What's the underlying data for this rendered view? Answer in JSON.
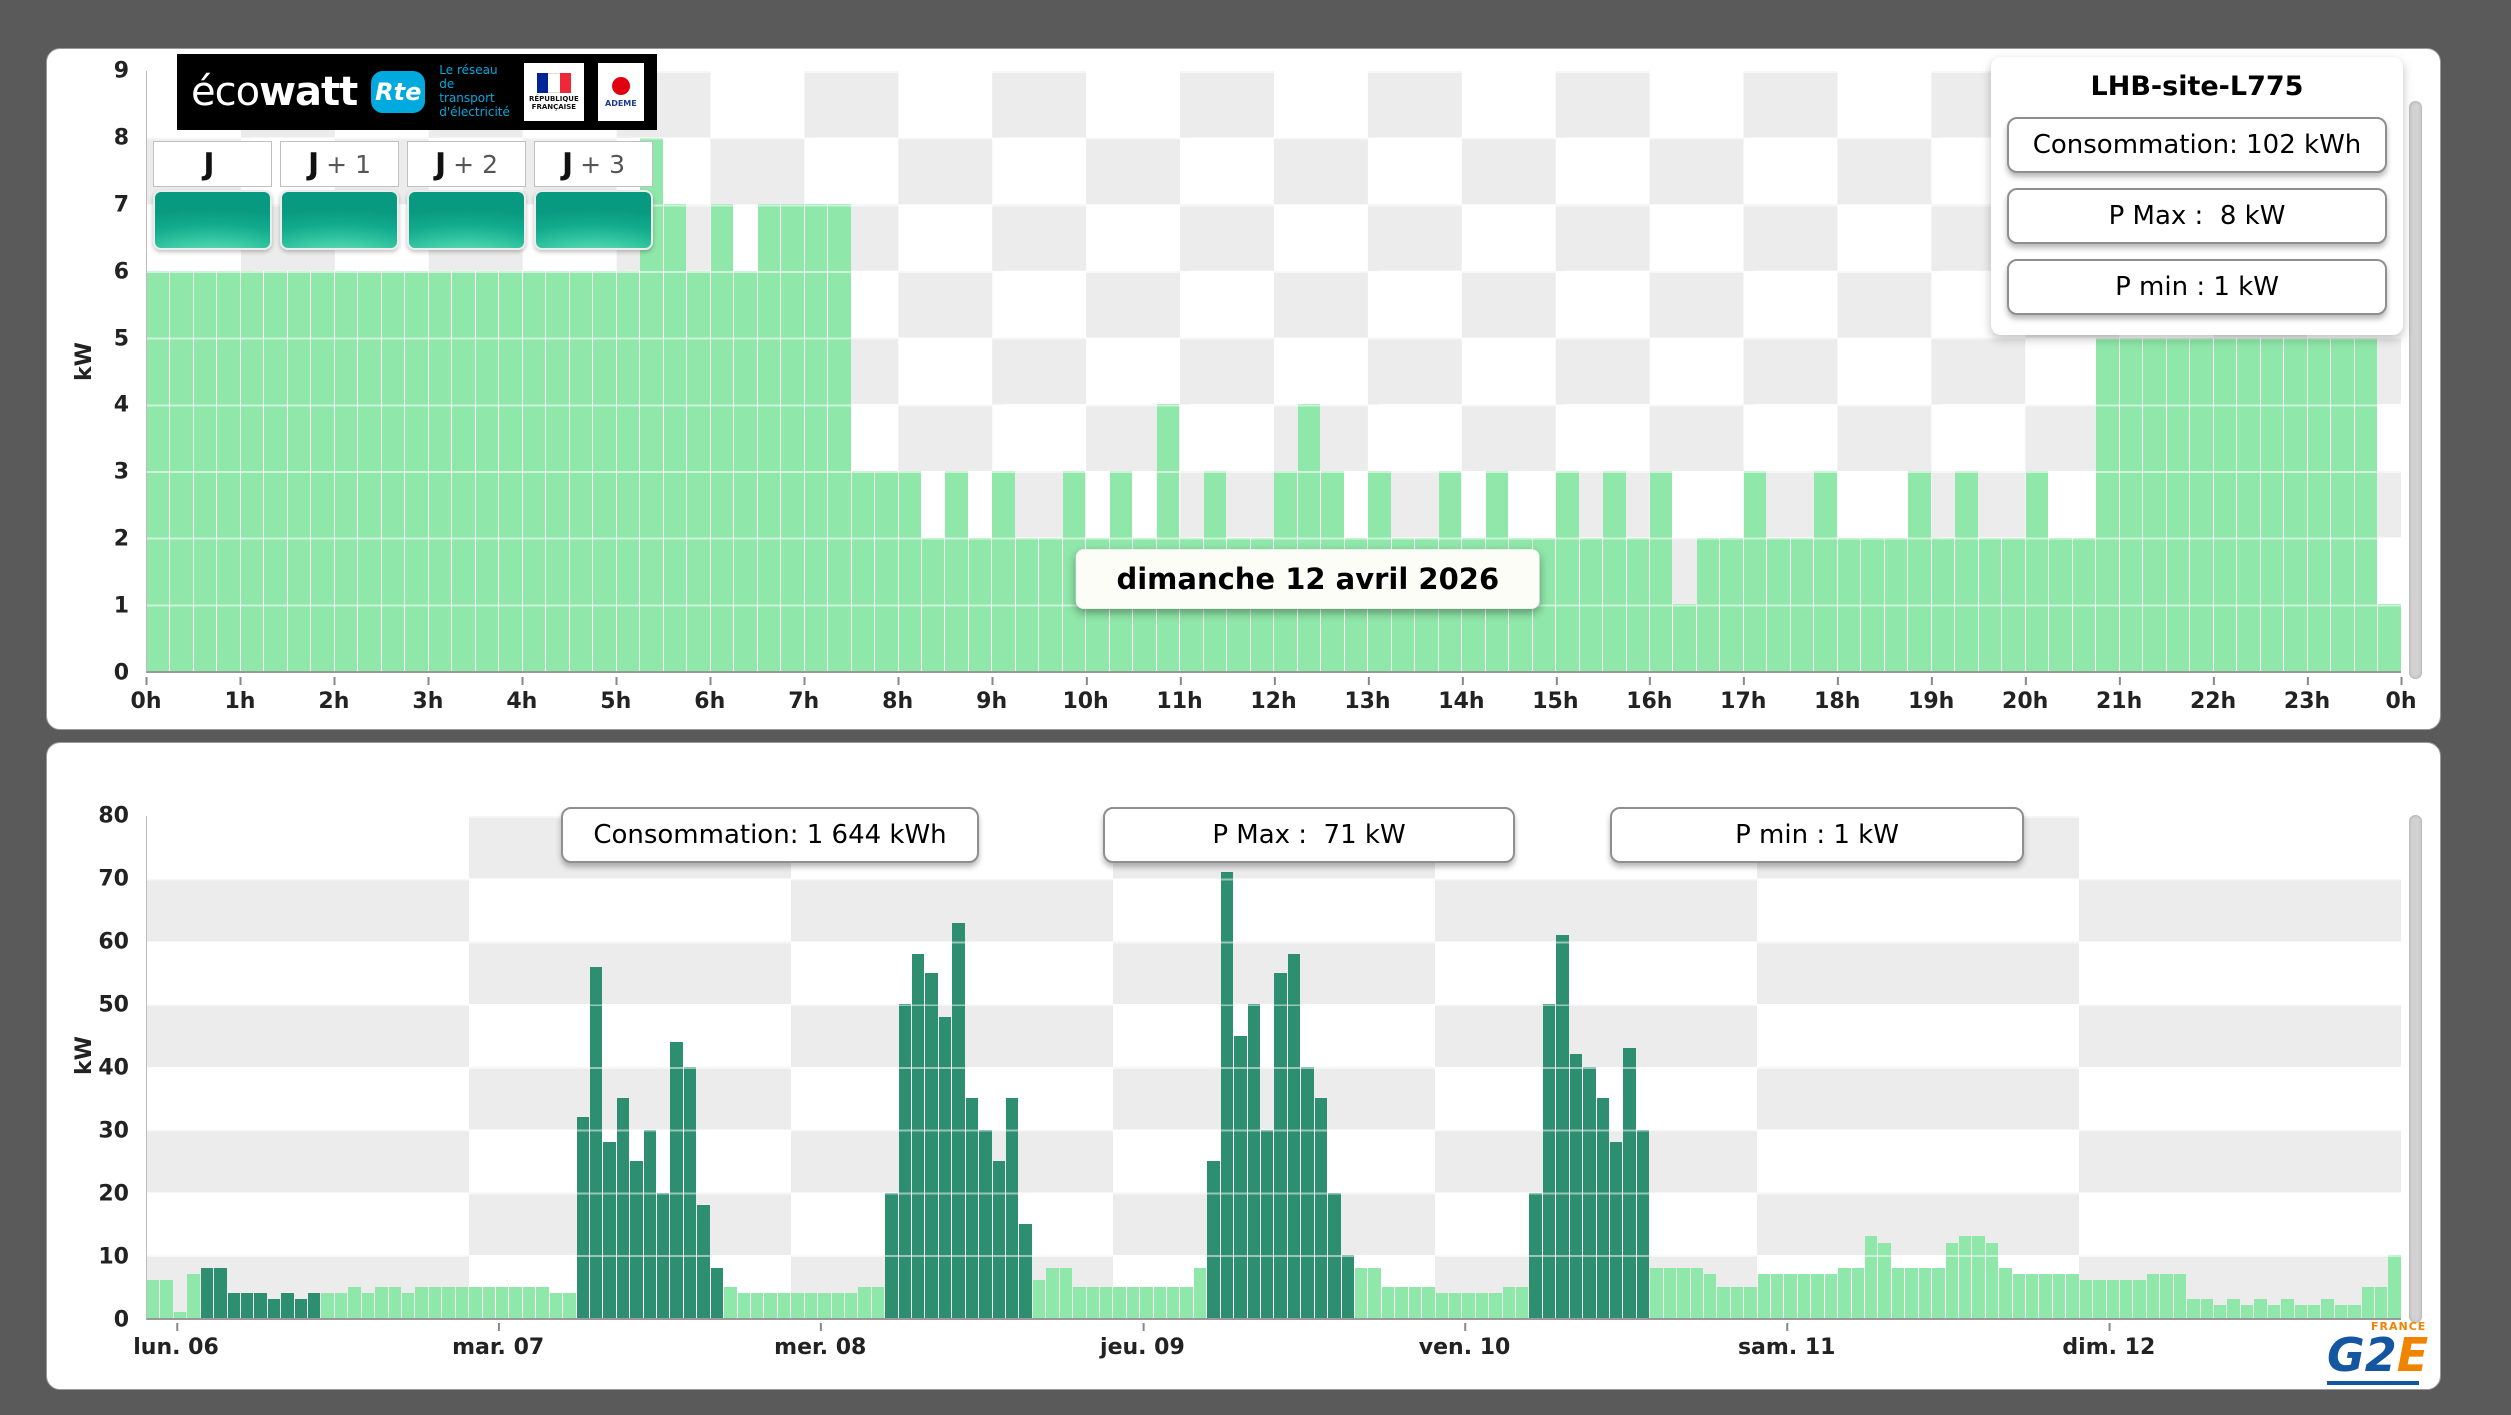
{
  "theme": {
    "background": "#5a5a5a",
    "panel": "#ffffff",
    "bar_light": "#8fe7a9",
    "bar_dark": "#2d8e70",
    "checker_gray": "#ececec"
  },
  "ecowatt": {
    "brand_eco": "éco",
    "brand_watt": "watt",
    "rte_badge": "Rte",
    "rte_tagline": "Le réseau de transport d'électricité",
    "gov_label": "RÉPUBLIQUE FRANÇAISE",
    "ademe_label": "ADEME"
  },
  "tabs": [
    {
      "j": "J",
      "plus": ""
    },
    {
      "j": "J",
      "plus": "+ 1"
    },
    {
      "j": "J",
      "plus": "+ 2"
    },
    {
      "j": "J",
      "plus": "+ 3"
    }
  ],
  "site": {
    "title": "LHB-site-L775"
  },
  "footer": {
    "g2": "G2",
    "e": "E",
    "france": "FRANCE"
  },
  "chart_data": [
    {
      "type": "bar",
      "title": "dimanche 12 avril 2026",
      "ylabel": "kW",
      "ylim": [
        0,
        9
      ],
      "yticks": [
        0,
        1,
        2,
        3,
        4,
        5,
        6,
        7,
        8,
        9
      ],
      "grid": "checkerboard",
      "interval_minutes": 15,
      "xtick_labels": [
        "0h",
        "1h",
        "2h",
        "3h",
        "4h",
        "5h",
        "6h",
        "7h",
        "8h",
        "9h",
        "10h",
        "11h",
        "12h",
        "13h",
        "14h",
        "15h",
        "16h",
        "17h",
        "18h",
        "19h",
        "20h",
        "21h",
        "22h",
        "23h",
        "0h"
      ],
      "stats": {
        "consumption": "Consommation: 102 kWh",
        "pmax": "P Max :  8 kW",
        "pmin": "P min : 1 kW"
      },
      "values": [
        6,
        6,
        6,
        6,
        6,
        6,
        6,
        6,
        6,
        6,
        6,
        6,
        6,
        6,
        6,
        6,
        6,
        6,
        6,
        6,
        6,
        8,
        7,
        6,
        7,
        6,
        7,
        7,
        7,
        7,
        3,
        3,
        3,
        2,
        3,
        2,
        3,
        2,
        2,
        3,
        2,
        3,
        2,
        4,
        2,
        3,
        2,
        2,
        3,
        4,
        3,
        2,
        3,
        2,
        2,
        3,
        2,
        3,
        2,
        2,
        3,
        2,
        3,
        2,
        3,
        1,
        2,
        2,
        3,
        2,
        2,
        3,
        2,
        2,
        2,
        3,
        2,
        3,
        2,
        2,
        3,
        2,
        2,
        5,
        5,
        5,
        5,
        5,
        5,
        5,
        5,
        5,
        5,
        5,
        5,
        1
      ]
    },
    {
      "type": "bar",
      "title": "",
      "ylabel": "kW",
      "ylim": [
        0,
        80
      ],
      "yticks": [
        0,
        10,
        20,
        30,
        40,
        50,
        60,
        70,
        80
      ],
      "grid": "checkerboard",
      "interval_minutes": 60,
      "stats": {
        "consumption": "Consommation: 1 644 kWh",
        "pmax": "P Max :  71 kW",
        "pmin": "P min : 1 kW"
      },
      "days": [
        {
          "label": "lun. 06",
          "values": [
            6,
            6,
            1,
            7,
            8,
            8,
            4,
            4,
            4,
            3,
            4,
            3,
            4,
            4,
            4,
            5,
            4,
            5,
            5,
            4,
            5,
            5,
            5,
            5
          ],
          "dark": [
            0,
            0,
            0,
            0,
            1,
            1,
            1,
            1,
            1,
            1,
            1,
            1,
            1,
            0,
            0,
            0,
            0,
            0,
            0,
            0,
            0,
            0,
            0,
            0
          ]
        },
        {
          "label": "mar. 07",
          "values": [
            5,
            5,
            5,
            5,
            5,
            5,
            4,
            4,
            32,
            56,
            28,
            35,
            25,
            30,
            20,
            44,
            40,
            18,
            8,
            5,
            4,
            4,
            4,
            4
          ],
          "dark": [
            0,
            0,
            0,
            0,
            0,
            0,
            0,
            0,
            1,
            1,
            1,
            1,
            1,
            1,
            1,
            1,
            1,
            1,
            1,
            0,
            0,
            0,
            0,
            0
          ]
        },
        {
          "label": "mer. 08",
          "values": [
            4,
            4,
            4,
            4,
            4,
            5,
            5,
            20,
            50,
            58,
            55,
            48,
            63,
            35,
            30,
            25,
            35,
            15,
            6,
            8,
            8,
            5,
            5,
            5
          ],
          "dark": [
            0,
            0,
            0,
            0,
            0,
            0,
            0,
            1,
            1,
            1,
            1,
            1,
            1,
            1,
            1,
            1,
            1,
            1,
            0,
            0,
            0,
            0,
            0,
            0
          ]
        },
        {
          "label": "jeu. 09",
          "values": [
            5,
            5,
            5,
            5,
            5,
            5,
            8,
            25,
            71,
            45,
            50,
            30,
            55,
            58,
            40,
            35,
            20,
            10,
            8,
            8,
            5,
            5,
            5,
            5
          ],
          "dark": [
            0,
            0,
            0,
            0,
            0,
            0,
            0,
            1,
            1,
            1,
            1,
            1,
            1,
            1,
            1,
            1,
            1,
            1,
            0,
            0,
            0,
            0,
            0,
            0
          ]
        },
        {
          "label": "ven. 10",
          "values": [
            4,
            4,
            4,
            4,
            4,
            5,
            5,
            20,
            50,
            61,
            42,
            40,
            35,
            28,
            43,
            30,
            8,
            8,
            8,
            8,
            7,
            5,
            5,
            5
          ],
          "dark": [
            0,
            0,
            0,
            0,
            0,
            0,
            0,
            1,
            1,
            1,
            1,
            1,
            1,
            1,
            1,
            1,
            0,
            0,
            0,
            0,
            0,
            0,
            0,
            0
          ]
        },
        {
          "label": "sam. 11",
          "values": [
            7,
            7,
            7,
            7,
            7,
            7,
            8,
            8,
            13,
            12,
            8,
            8,
            8,
            8,
            12,
            13,
            13,
            12,
            8,
            7,
            7,
            7,
            7,
            7
          ],
          "dark": [
            0,
            0,
            0,
            0,
            0,
            0,
            0,
            0,
            0,
            0,
            0,
            0,
            0,
            0,
            0,
            0,
            0,
            0,
            0,
            0,
            0,
            0,
            0,
            0
          ]
        },
        {
          "label": "dim. 12",
          "values": [
            6,
            6,
            6,
            6,
            6,
            7,
            7,
            7,
            3,
            3,
            2,
            3,
            2,
            3,
            2,
            3,
            2,
            2,
            3,
            2,
            2,
            5,
            5,
            10
          ],
          "dark": [
            0,
            0,
            0,
            0,
            0,
            0,
            0,
            0,
            0,
            0,
            0,
            0,
            0,
            0,
            0,
            0,
            0,
            0,
            0,
            0,
            0,
            0,
            0,
            0
          ]
        }
      ]
    }
  ]
}
